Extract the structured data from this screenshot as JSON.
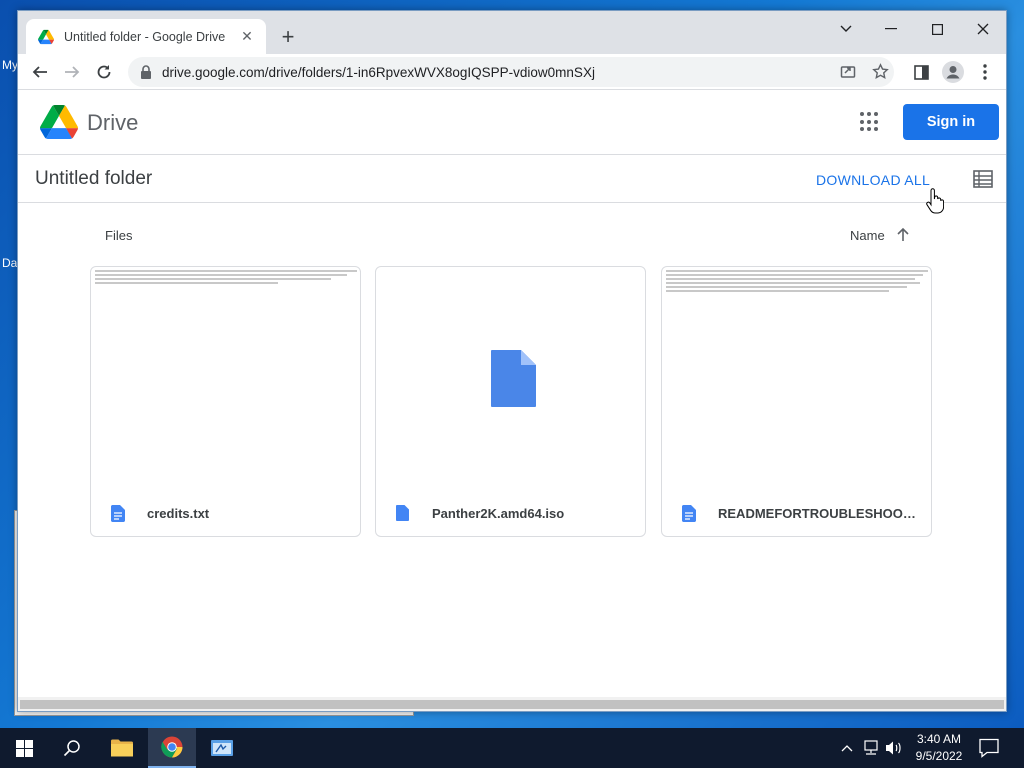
{
  "desktop": {
    "icon_labels": [
      "My",
      "Da"
    ]
  },
  "browser": {
    "tab": {
      "title": "Untitled folder - Google Drive",
      "close": "✕"
    },
    "new_tab": "+",
    "window_controls": {
      "dropdown": "⌄",
      "minimize": "—",
      "maximize": "☐",
      "close": "✕"
    },
    "url": "drive.google.com/drive/folders/1-in6RpvexWVX8ogIQSPP-vdiow0mnSXj"
  },
  "drive": {
    "brand": "Drive",
    "sign_in": "Sign in",
    "folder_title": "Untitled folder",
    "download_all": "DOWNLOAD ALL",
    "files_label": "Files",
    "sort_label": "Name",
    "files": [
      {
        "name": "credits.txt",
        "preview": "text"
      },
      {
        "name": "Panther2K.amd64.iso",
        "preview": "doc-icon"
      },
      {
        "name": "READMEFORTROUBLESHOOTIN...",
        "preview": "text"
      }
    ]
  },
  "taskbar": {
    "time": "3:40 AM",
    "date": "9/5/2022"
  },
  "colors": {
    "accent": "#1a73e8",
    "doc_blue": "#4285f4",
    "taskbar": "#0f1a2e"
  }
}
